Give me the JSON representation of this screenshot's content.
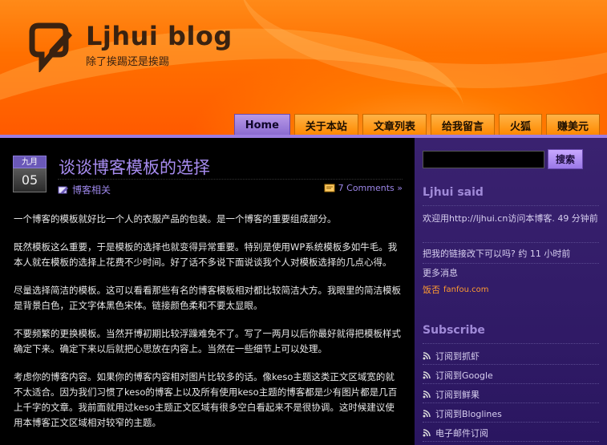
{
  "header": {
    "title": "Ljhui blog",
    "subtitle": "除了挨踢还是挨踢"
  },
  "nav": [
    {
      "label": "Home",
      "active": true
    },
    {
      "label": "关于本站",
      "active": false
    },
    {
      "label": "文章列表",
      "active": false
    },
    {
      "label": "给我留言",
      "active": false
    },
    {
      "label": "火狐",
      "active": false
    },
    {
      "label": "赚美元",
      "active": false
    }
  ],
  "post": {
    "month": "九月",
    "day": "05",
    "title": "谈谈博客模板的选择",
    "category": "博客相关",
    "comments": "7 Comments »",
    "paragraphs": [
      "一个博客的模板就好比一个人的衣服产品的包装。是一个博客的重要组成部分。",
      "既然模板这么重要，于是模板的选择也就变得异常重要。特别是使用WP系统模板多如牛毛。我本人就在模板的选择上花费不少时间。好了话不多说下面说谈我个人对模板选择的几点心得。",
      "尽量选择简洁的模板。这可以看看那些有名的博客模板相对都比较简洁大方。我眼里的简洁模板是背景白色，正文字体黑色宋体。链接颜色柔和不要太显眼。",
      "不要频繁的更换模板。当然开博初期比较浮躁难免不了。写了一两月以后你最好就得把模板样式确定下来。确定下来以后就把心思放在内容上。当然在一些细节上可以处理。",
      "考虑你的博客内容。如果你的博客内容相对图片比较多的话。像keso主题这类正文区域宽的就不太适合。因为我们习惯了keso的博客上以及所有使用keso主题的博客都是少有图片都是几百上千字的文章。我前面就用过keso主题正文区域有很多空白看起来不是很协调。这时候建议使用本博客正文区域相对较窄的主题。"
    ]
  },
  "sidebar": {
    "search_button": "搜索",
    "said_heading": "Ljhui said",
    "said_items": [
      "欢迎用http://ljhui.cn访问本博客. 49 分钟前",
      "把我的链接改下可以吗? 约 11 小时前",
      "更多消息"
    ],
    "fanfou_label": "饭否",
    "fanfou_name": "fanfou.com",
    "subscribe_heading": "Subscribe",
    "subscribe_items": [
      "订阅到抓虾",
      "订阅到Google",
      "订阅到鲜果",
      "订阅到Bloglines",
      "电子邮件订阅"
    ]
  },
  "colors": {
    "accent": "#a78cf0",
    "header": "#ff7a00",
    "sidebar": "#2a1660"
  }
}
